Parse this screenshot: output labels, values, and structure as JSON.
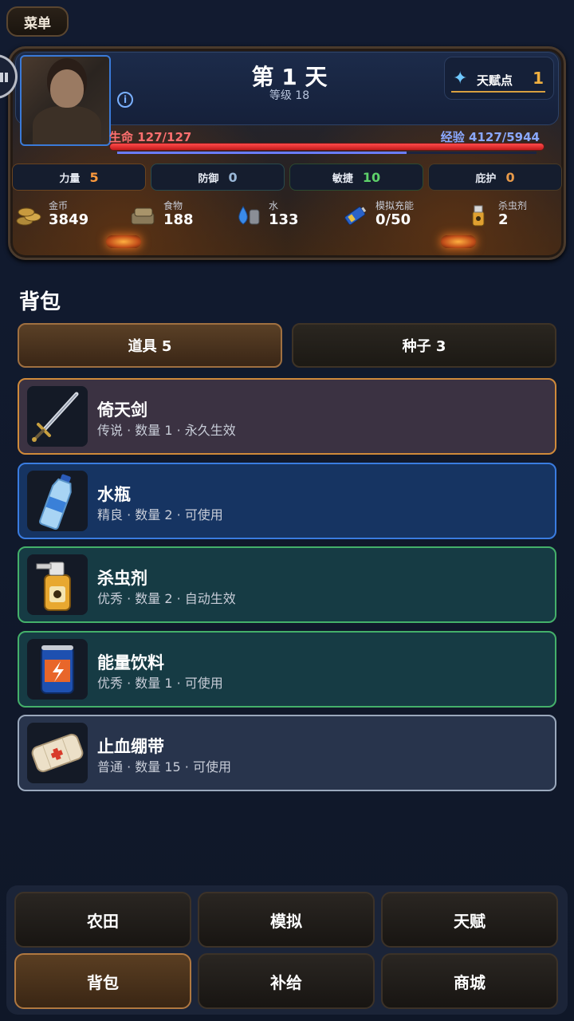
{
  "menu_label": "菜单",
  "header": {
    "day": "第 1 天",
    "level": "等级 18",
    "talent_label": "天赋点",
    "talent_value": "1",
    "hp_label": "生命 127/127",
    "hp_fraction": 1.0,
    "xp_label": "经验 4127/5944",
    "xp_fraction": 0.69
  },
  "stats": [
    {
      "label": "力量",
      "value": "5"
    },
    {
      "label": "防御",
      "value": "0"
    },
    {
      "label": "敏捷",
      "value": "10"
    },
    {
      "label": "庇护",
      "value": "0"
    }
  ],
  "resources": [
    {
      "name": "金币",
      "value": "3849",
      "icon": "coins-icon"
    },
    {
      "name": "食物",
      "value": "188",
      "icon": "food-icon"
    },
    {
      "name": "水",
      "value": "133",
      "icon": "water-icon"
    },
    {
      "name": "模拟充能",
      "value": "0/50",
      "icon": "battery-icon"
    },
    {
      "name": "杀虫剂",
      "value": "2",
      "icon": "spray-icon"
    }
  ],
  "backpack": {
    "title": "背包",
    "tabs": [
      {
        "label": "道具 5"
      },
      {
        "label": "种子 3"
      }
    ],
    "items": [
      {
        "name": "倚天剑",
        "desc": "传说 · 数量 1 · 永久生效",
        "icon": "sword-icon"
      },
      {
        "name": "水瓶",
        "desc": "精良 · 数量 2 · 可使用",
        "icon": "water-bottle-icon"
      },
      {
        "name": "杀虫剂",
        "desc": "优秀 · 数量 2 · 自动生效",
        "icon": "insecticide-icon"
      },
      {
        "name": "能量饮料",
        "desc": "优秀 · 数量 1 · 可使用",
        "icon": "energy-drink-icon"
      },
      {
        "name": "止血绷带",
        "desc": "普通 · 数量 15 · 可使用",
        "icon": "bandage-icon"
      }
    ]
  },
  "nav": [
    {
      "label": "农田"
    },
    {
      "label": "模拟"
    },
    {
      "label": "天赋"
    },
    {
      "label": "背包"
    },
    {
      "label": "补给"
    },
    {
      "label": "商城"
    }
  ]
}
